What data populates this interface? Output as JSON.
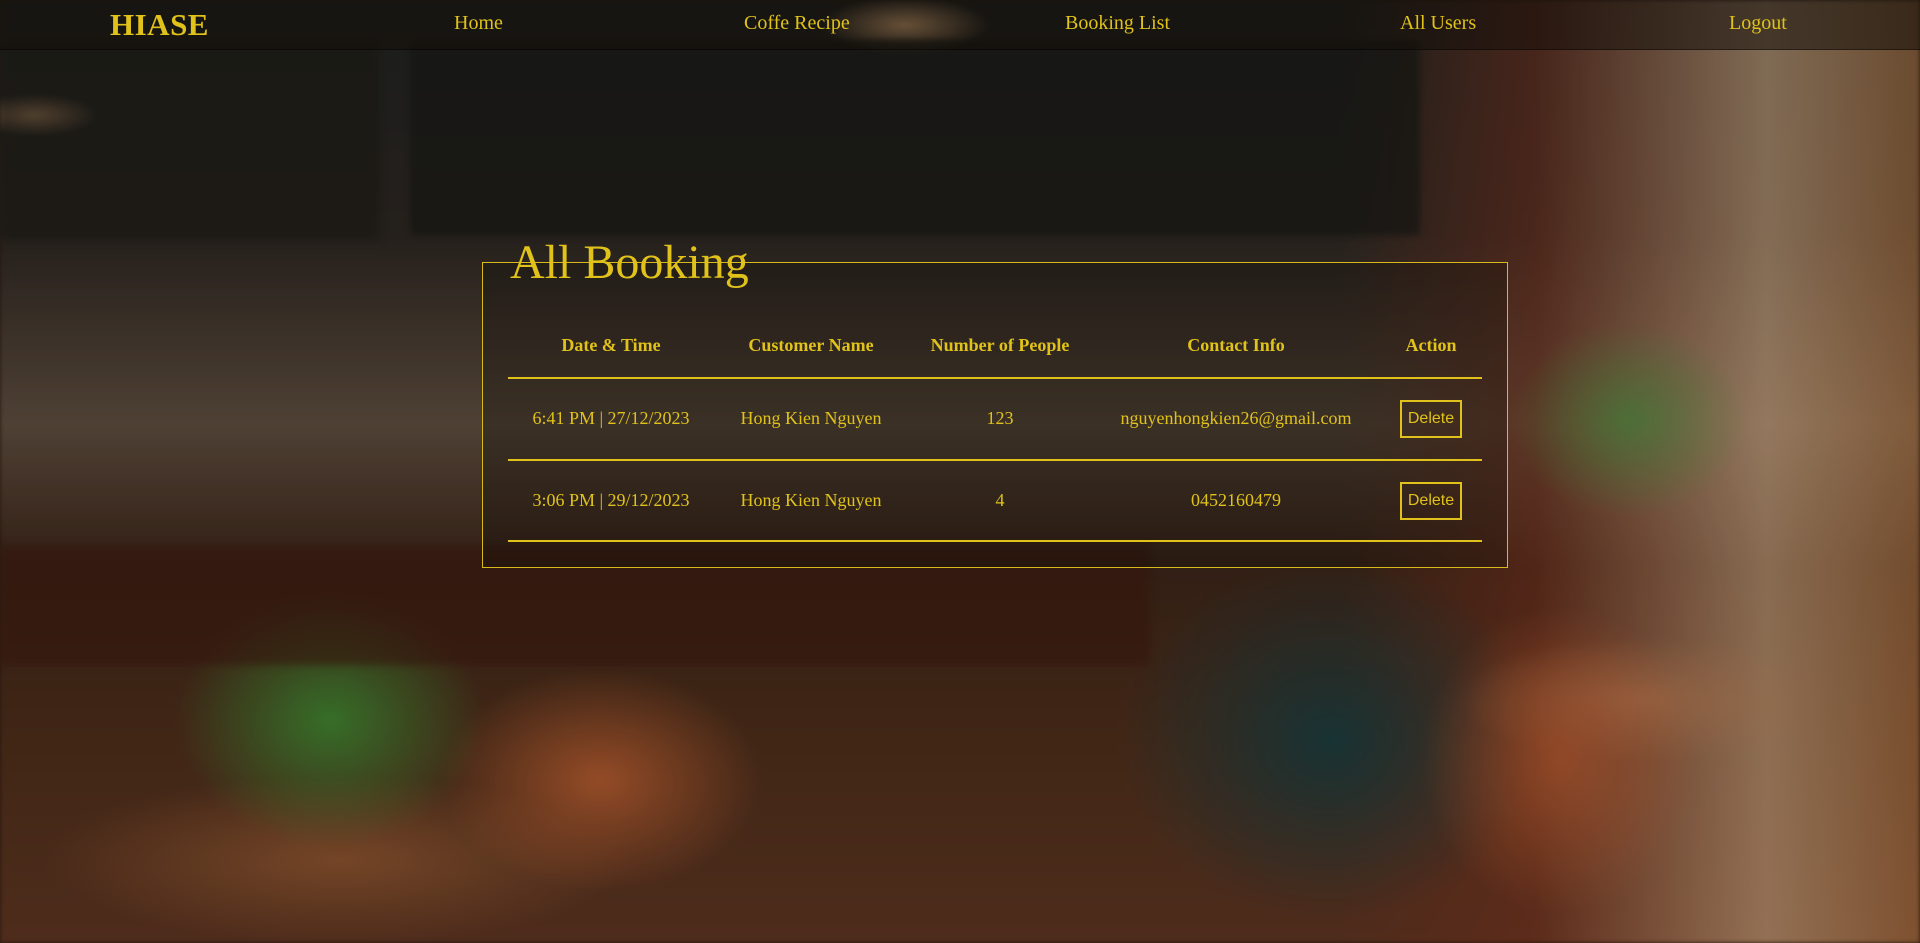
{
  "navbar": {
    "brand": "HIASE",
    "links": [
      "Home",
      "Coffe Recipe",
      "Booking List",
      "All Users",
      "Logout"
    ]
  },
  "bookings": {
    "title": "All Booking",
    "headers": [
      "Date & Time",
      "Customer Name",
      "Number of People",
      "Contact Info",
      "Action"
    ],
    "rows": [
      {
        "datetime": "6:41 PM | 27/12/2023",
        "customer": "Hong Kien Nguyen",
        "people": "123",
        "contact": "nguyenhongkien26@gmail.com",
        "action": "Delete"
      },
      {
        "datetime": "3:06 PM | 29/12/2023",
        "customer": "Hong Kien Nguyen",
        "people": "4",
        "contact": "0452160479",
        "action": "Delete"
      }
    ]
  },
  "colors": {
    "accent": "#e0c21a"
  }
}
